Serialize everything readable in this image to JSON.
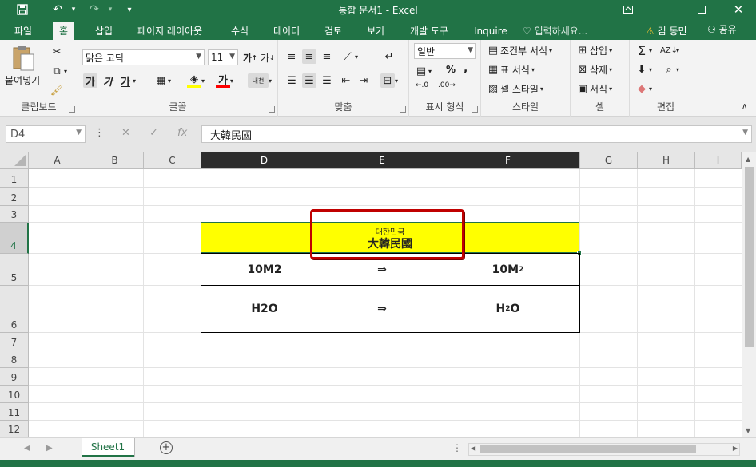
{
  "window": {
    "title": "통합 문서1 - Excel",
    "icons": {
      "save": "save-icon",
      "undo": "undo-icon",
      "redo": "redo-icon",
      "customize": "customize-quick-access-icon"
    }
  },
  "tabs": [
    "파일",
    "홈",
    "삽입",
    "페이지 레이아웃",
    "수식",
    "데이터",
    "검토",
    "보기",
    "개발 도구",
    "Inquire"
  ],
  "active_tab": "홈",
  "tell_me": "입력하세요...",
  "user": "김 동민",
  "share": "공유",
  "ribbon": {
    "clipboard": {
      "label": "클립보드",
      "paste": "붙여넣기"
    },
    "font": {
      "label": "글꼴",
      "name": "맑은 고딕",
      "size": "11",
      "bold": "가",
      "italic": "가",
      "underline": "가",
      "font_color": "가",
      "phonetic": "내천"
    },
    "alignment": {
      "label": "맞춤"
    },
    "number": {
      "label": "표시 형식",
      "format": "일반",
      "percent": "%",
      "comma": ","
    },
    "styles": {
      "label": "스타일",
      "conditional": "조건부 서식",
      "table": "표 서식",
      "cell": "셀 스타일"
    },
    "cells": {
      "label": "셀",
      "insert": "삽입",
      "delete": "삭제",
      "format": "서식"
    },
    "editing": {
      "label": "편집"
    }
  },
  "formula_bar": {
    "name_box": "D4",
    "formula": "大韓民國"
  },
  "columns": [
    "A",
    "B",
    "C",
    "D",
    "E",
    "F",
    "G",
    "H",
    "I"
  ],
  "selected_column": "D",
  "rows": [
    "1",
    "2",
    "3",
    "4",
    "5",
    "6",
    "7",
    "8",
    "9",
    "10",
    "11",
    "12"
  ],
  "selected_row": "4",
  "cells": {
    "d4_ruby": "대한민국",
    "d4_text": "大韓民國",
    "d5": "10M2",
    "e5": "⇒",
    "f5_base": "10M",
    "f5_sup": "2",
    "d6": "H2O",
    "e6": "⇒",
    "f6_h": "H",
    "f6_sub": "2",
    "f6_o": "O"
  },
  "highlight_color": "#ffff00",
  "accent_color": "#217346",
  "callout_color": "#c00000",
  "sheets": [
    "Sheet1"
  ]
}
